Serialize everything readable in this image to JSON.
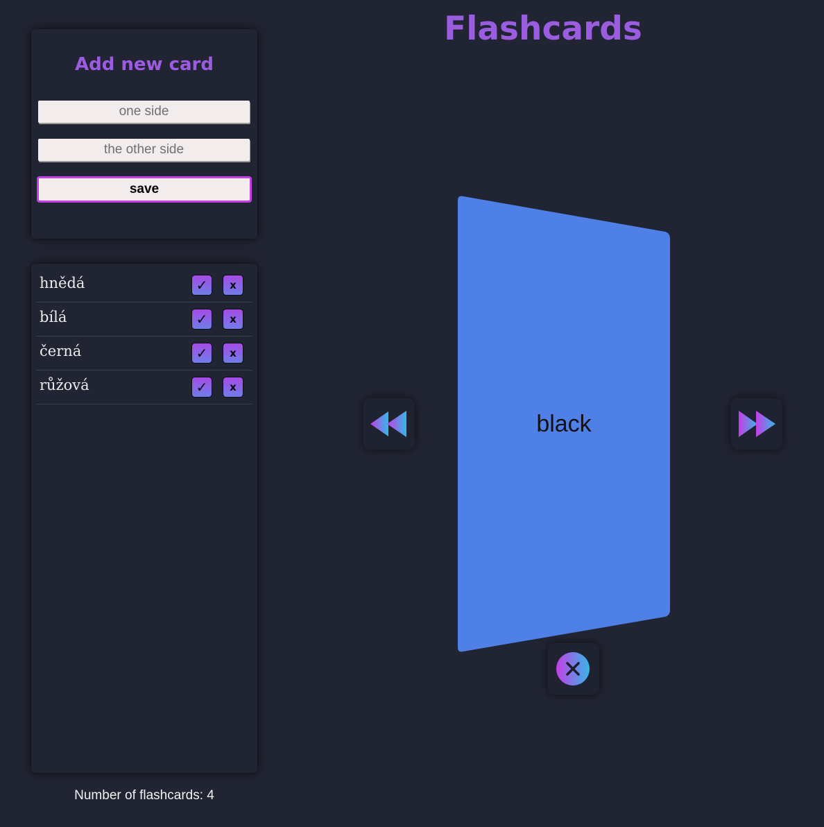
{
  "header": {
    "title": "Flashcards"
  },
  "add_form": {
    "title": "Add new card",
    "front_placeholder": "one side",
    "back_placeholder": "the other side",
    "save_label": "save"
  },
  "card_list": {
    "items": [
      {
        "word": "hnědá",
        "check_icon": "✓",
        "delete_label": "x"
      },
      {
        "word": "bílá",
        "check_icon": "✓",
        "delete_label": "x"
      },
      {
        "word": "černá",
        "check_icon": "✓",
        "delete_label": "x"
      },
      {
        "word": "růžová",
        "check_icon": "✓",
        "delete_label": "x"
      }
    ]
  },
  "footer": {
    "count_text": "Number of flashcards: 4"
  },
  "flashcard": {
    "text": "black",
    "color": "#4f80e8"
  },
  "controls": {
    "prev_icon": "rewind-icon",
    "next_icon": "fast-forward-icon",
    "close_icon": "close-circle-icon"
  },
  "colors": {
    "background": "#212432",
    "accent_purple": "#9c5be0",
    "accent_magenta": "#c43ee6",
    "accent_cyan": "#35b7e8"
  }
}
